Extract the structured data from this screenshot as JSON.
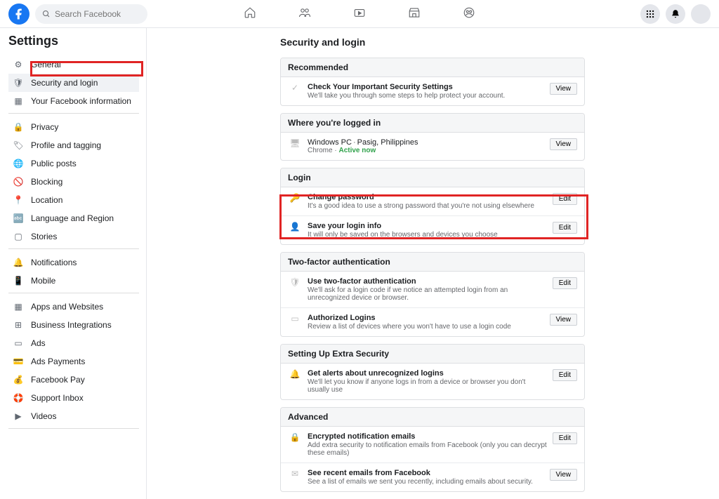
{
  "topbar": {
    "search_placeholder": "Search Facebook"
  },
  "sidebar": {
    "title": "Settings",
    "groups": [
      [
        "General",
        "Security and login",
        "Your Facebook information"
      ],
      [
        "Privacy",
        "Profile and tagging",
        "Public posts",
        "Blocking",
        "Location",
        "Language and Region",
        "Stories"
      ],
      [
        "Notifications",
        "Mobile"
      ],
      [
        "Apps and Websites",
        "Business Integrations",
        "Ads",
        "Ads Payments",
        "Facebook Pay",
        "Support Inbox",
        "Videos"
      ]
    ],
    "active": "Security and login"
  },
  "page_title": "Security and login",
  "sections": {
    "recommended": {
      "header": "Recommended",
      "item": {
        "title": "Check Your Important Security Settings",
        "sub": "We'll take you through some steps to help protect your account.",
        "action": "View"
      }
    },
    "logged_in": {
      "header": "Where you're logged in",
      "device": {
        "name": "Windows PC",
        "location": "Pasig, Philippines",
        "browser": "Chrome",
        "status": "Active now",
        "action": "View"
      }
    },
    "login": {
      "header": "Login",
      "items": [
        {
          "title": "Change password",
          "sub": "It's a good idea to use a strong password that you're not using elsewhere",
          "action": "Edit"
        },
        {
          "title": "Save your login info",
          "sub": "It will only be saved on the browsers and devices you choose",
          "action": "Edit"
        }
      ]
    },
    "two_factor": {
      "header": "Two-factor authentication",
      "items": [
        {
          "title": "Use two-factor authentication",
          "sub": "We'll ask for a login code if we notice an attempted login from an unrecognized device or browser.",
          "action": "Edit"
        },
        {
          "title": "Authorized Logins",
          "sub": "Review a list of devices where you won't have to use a login code",
          "action": "View"
        }
      ]
    },
    "extra": {
      "header": "Setting Up Extra Security",
      "item": {
        "title": "Get alerts about unrecognized logins",
        "sub": "We'll let you know if anyone logs in from a device or browser you don't usually use",
        "action": "Edit"
      }
    },
    "advanced": {
      "header": "Advanced",
      "items": [
        {
          "title": "Encrypted notification emails",
          "sub": "Add extra security to notification emails from Facebook (only you can decrypt these emails)",
          "action": "Edit"
        },
        {
          "title": "See recent emails from Facebook",
          "sub": "See a list of emails we sent you recently, including emails about security.",
          "action": "View"
        }
      ]
    }
  }
}
